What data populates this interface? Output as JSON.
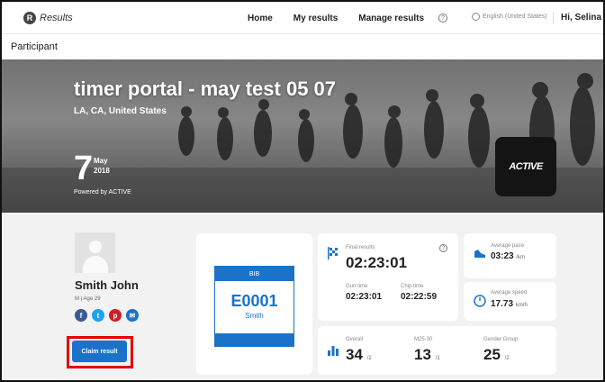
{
  "nav": {
    "logo_text": "Results",
    "logo_mark": "R",
    "links": [
      "Home",
      "My results",
      "Manage results"
    ],
    "help_symbol": "?",
    "language": "English (United States)",
    "user": "Hi, Selina"
  },
  "page": {
    "section_title": "Participant"
  },
  "hero": {
    "title": "timer portal - may test 05 07",
    "location": "LA, CA, United States",
    "day": "7",
    "month": "May",
    "year": "2018",
    "powered_by": "Powered by ACTIVE",
    "brand_logo": "ACTIVE"
  },
  "participant": {
    "name": "Smith John",
    "meta": "M | Age 29",
    "socials": [
      {
        "icon": "facebook-icon",
        "glyph": "f",
        "color": "#3b5998"
      },
      {
        "icon": "twitter-icon",
        "glyph": "t",
        "color": "#1da1f2"
      },
      {
        "icon": "pinterest-icon",
        "glyph": "p",
        "color": "#cb2027"
      },
      {
        "icon": "email-icon",
        "glyph": "✉",
        "color": "#1a73c9"
      }
    ],
    "claim_label": "Claim result"
  },
  "bib": {
    "label": "BIB",
    "number": "E0001",
    "name": "Smith"
  },
  "results": {
    "final_label": "Final results",
    "final_value": "02:23:01",
    "help_symbol": "?",
    "gun_label": "Gun time",
    "gun_value": "02:23:01",
    "chip_label": "Chip time",
    "chip_value": "02:22:59"
  },
  "pace": {
    "label": "Average pace",
    "value": "03:23",
    "unit": "/km"
  },
  "speed": {
    "label": "Average speed",
    "value": "17.73",
    "unit": "km/h"
  },
  "ranks": {
    "overall_label": "Overall",
    "overall_value": "34",
    "overall_total": "/2",
    "age_label": "M25-30",
    "age_value": "13",
    "age_total": "/1",
    "gender_label": "Gender Group",
    "gender_value": "25",
    "gender_total": "/2"
  },
  "colors": {
    "accent": "#1a73c9",
    "highlight": "#e60000",
    "panel": "#f2f2f2"
  }
}
